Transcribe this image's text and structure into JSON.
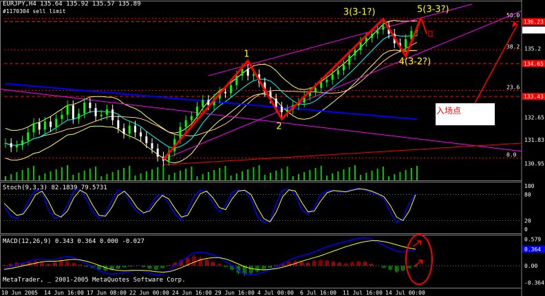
{
  "main": {
    "header": "EURJPY,H4  135.64 135.92 135.57 135.89",
    "order_label": "#1170304 sell limit"
  },
  "stoch": {
    "header": "Stoch(9,3,3) 82.1839 79.5731"
  },
  "macd": {
    "header": "MACD(12,26,9) 0.343 0.364 0.000 -0.027"
  },
  "footer": {
    "copyright": "MetaTrader, _ 2001-2005 MetaQuotes Software Corp."
  },
  "annotations": {
    "entry_point": "入场点"
  },
  "colors": {
    "bull_candle": "#00ff00",
    "bear_candle": "#ffffff",
    "wave_line": "#ff0000",
    "wave_label": "#ffff00",
    "ma_blue": "#0000ff",
    "bands": "#ffff66",
    "channel": "#ff00ff",
    "fib_line": "#ff0000",
    "volume": "#00cc00",
    "stoch_main": "#ffff00",
    "stoch_signal": "#0000ff",
    "macd_line": "#ffff00",
    "macd_signal": "#0000ff",
    "macd_hist_up": "#ff0000",
    "macd_hist_down": "#00cc00"
  },
  "chart_data": [
    {
      "type": "candlestick",
      "title": "EURJPY,H4",
      "ylim": [
        130.4,
        136.9
      ],
      "y_ticks": [
        {
          "value": 136.2,
          "label": "136.23",
          "highlight": true
        },
        {
          "value": 135.89,
          "label": "135.89",
          "highlight": false,
          "current": true
        },
        {
          "value": 135.2,
          "label": "135.2",
          "highlight": false
        },
        {
          "value": 134.65,
          "label": "134.65",
          "highlight": true
        },
        {
          "value": 133.43,
          "label": "133.43",
          "highlight": true
        },
        {
          "value": 132.65,
          "label": "132.65",
          "highlight": false
        },
        {
          "value": 131.83,
          "label": "131.83",
          "highlight": false
        },
        {
          "value": 130.95,
          "label": "130.95",
          "highlight": false
        }
      ],
      "fib_levels": [
        {
          "label": "50.0",
          "value": 136.32
        },
        {
          "label": "38.2",
          "value": 135.16
        },
        {
          "label": "23.6",
          "value": 133.65
        },
        {
          "label": "0.0",
          "value": 131.15
        }
      ],
      "x_ticks": [
        "10 Jun 2005",
        "14 Jun 16:00",
        "17 Jun 08:00",
        "22 Jun 00:00",
        "24 Jun 16:00",
        "29 Jun 16:00",
        "4 Jul 00:00",
        "6 Jul 16:00",
        "11 Jul 16:00",
        "14 Jul 00:00"
      ],
      "close": [
        131.7,
        131.55,
        131.62,
        131.8,
        132.1,
        132.45,
        132.2,
        132.5,
        132.3,
        132.6,
        132.75,
        133.1,
        132.6,
        132.8,
        133.2,
        133.0,
        132.7,
        132.75,
        132.95,
        132.55,
        132.25,
        132.05,
        132.35,
        132.1,
        131.95,
        131.7,
        131.5,
        131.2,
        131.05,
        131.4,
        131.85,
        132.3,
        132.55,
        132.7,
        133.05,
        133.3,
        133.1,
        133.35,
        133.6,
        133.55,
        133.85,
        134.2,
        134.45,
        134.2,
        134.25,
        133.95,
        133.6,
        133.35,
        133.05,
        132.85,
        132.95,
        133.1,
        133.2,
        133.45,
        133.6,
        133.75,
        133.95,
        134.05,
        134.25,
        134.4,
        134.6,
        134.95,
        135.15,
        135.45,
        135.6,
        135.75,
        135.9,
        136.05,
        135.75,
        135.4,
        135.25,
        135.55,
        135.85,
        135.89
      ],
      "waves": [
        {
          "label": "1",
          "price": 134.75
        },
        {
          "label": "2",
          "price": 132.6
        },
        {
          "label": "3(3-1?)",
          "price": 136.3
        },
        {
          "label": "4(3-2?)",
          "price": 134.92
        },
        {
          "label": "5(3-3?)",
          "price": 136.35
        }
      ],
      "wave_start_price": 131.1
    },
    {
      "type": "line",
      "title": "Stoch(9,3,3)",
      "ylim": [
        0,
        100
      ],
      "y_ticks": [
        "100",
        "80",
        "20",
        "0"
      ],
      "series": [
        {
          "name": "Stoch",
          "values": [
            55,
            30,
            25,
            40,
            70,
            90,
            85,
            45,
            25,
            30,
            55,
            88,
            92,
            70,
            40,
            25,
            35,
            65,
            90,
            85,
            60,
            40,
            35,
            50,
            75,
            80,
            60,
            35,
            20,
            45,
            75,
            90,
            85,
            60,
            40,
            55,
            85,
            90,
            88,
            70,
            30,
            15,
            20,
            60,
            90,
            92,
            80,
            45,
            35,
            50,
            80,
            88,
            90,
            85,
            88,
            92,
            95,
            90,
            85,
            80,
            70,
            40,
            15,
            25,
            60,
            82
          ]
        },
        {
          "name": "Signal",
          "values": [
            60,
            45,
            32,
            35,
            55,
            80,
            88,
            65,
            35,
            28,
            42,
            72,
            90,
            82,
            55,
            32,
            30,
            50,
            78,
            88,
            72,
            50,
            38,
            42,
            62,
            78,
            70,
            48,
            28,
            32,
            58,
            82,
            88,
            72,
            50,
            45,
            70,
            88,
            90,
            80,
            50,
            25,
            17,
            40,
            75,
            91,
            88,
            62,
            40,
            42,
            65,
            84,
            89,
            88,
            86,
            90,
            93,
            92,
            88,
            82,
            75,
            55,
            28,
            20,
            42,
            79.6
          ]
        }
      ]
    },
    {
      "type": "bar",
      "title": "MACD(12,26,9)",
      "ylim": [
        -0.42,
        0.62
      ],
      "y_ticks": [
        "0.579",
        "0.364",
        "0.00",
        "-0.364"
      ],
      "series": [
        {
          "name": "Histogram",
          "values": [
            0.02,
            0.05,
            0.08,
            0.06,
            0.1,
            0.12,
            0.08,
            0.05,
            0.09,
            0.14,
            0.11,
            0.07,
            0.03,
            -0.02,
            -0.05,
            -0.09,
            -0.12,
            -0.1,
            -0.07,
            -0.04,
            -0.02,
            0.01,
            -0.03,
            -0.07,
            -0.1,
            -0.06,
            0.02,
            0.08,
            0.14,
            0.2,
            0.24,
            0.2,
            0.15,
            0.1,
            0.05,
            -0.03,
            -0.1,
            -0.18,
            -0.22,
            -0.19,
            -0.15,
            -0.1,
            -0.05,
            0.02,
            0.06,
            0.1,
            0.12,
            0.1,
            0.08,
            0.12,
            0.14,
            0.13,
            0.1,
            0.08,
            0.06,
            0.09,
            0.11,
            0.1,
            0.05,
            0.0,
            -0.05,
            -0.1,
            -0.15,
            -0.12,
            -0.06,
            -0.027
          ]
        },
        {
          "name": "MACD",
          "values": [
            -0.05,
            -0.02,
            0.03,
            0.06,
            0.1,
            0.14,
            0.15,
            0.13,
            0.14,
            0.18,
            0.2,
            0.18,
            0.12,
            0.05,
            -0.02,
            -0.1,
            -0.16,
            -0.18,
            -0.17,
            -0.15,
            -0.12,
            -0.1,
            -0.12,
            -0.16,
            -0.2,
            -0.18,
            -0.1,
            0.0,
            0.1,
            0.2,
            0.28,
            0.3,
            0.28,
            0.24,
            0.18,
            0.1,
            0.0,
            -0.1,
            -0.18,
            -0.2,
            -0.18,
            -0.14,
            -0.08,
            -0.02,
            0.05,
            0.12,
            0.18,
            0.22,
            0.25,
            0.3,
            0.36,
            0.42,
            0.46,
            0.5,
            0.53,
            0.57,
            0.6,
            0.61,
            0.58,
            0.52,
            0.45,
            0.38,
            0.32,
            0.3,
            0.33,
            0.343
          ]
        },
        {
          "name": "Signal",
          "values": [
            -0.08,
            -0.06,
            -0.03,
            0.0,
            0.03,
            0.06,
            0.09,
            0.1,
            0.1,
            0.11,
            0.13,
            0.14,
            0.13,
            0.1,
            0.06,
            0.01,
            -0.04,
            -0.08,
            -0.1,
            -0.11,
            -0.1,
            -0.1,
            -0.1,
            -0.11,
            -0.13,
            -0.14,
            -0.13,
            -0.09,
            -0.04,
            0.02,
            0.08,
            0.13,
            0.16,
            0.18,
            0.18,
            0.15,
            0.1,
            0.04,
            -0.02,
            -0.06,
            -0.08,
            -0.09,
            -0.08,
            -0.06,
            -0.03,
            0.01,
            0.05,
            0.1,
            0.14,
            0.18,
            0.22,
            0.27,
            0.32,
            0.37,
            0.42,
            0.46,
            0.5,
            0.53,
            0.55,
            0.55,
            0.53,
            0.5,
            0.46,
            0.42,
            0.39,
            0.364
          ]
        }
      ]
    }
  ]
}
